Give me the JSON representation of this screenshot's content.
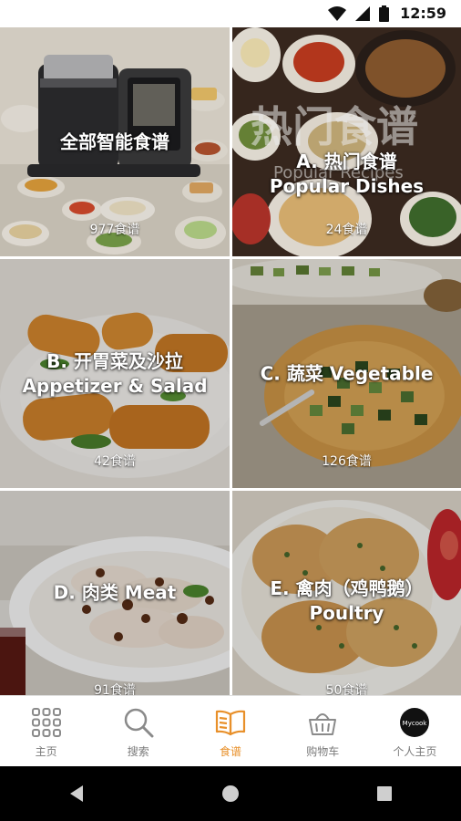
{
  "status_bar": {
    "time": "12:59"
  },
  "tiles": [
    {
      "title": "全部智能食谱",
      "count": "977食谱"
    },
    {
      "title": "A. 热门食谱\nPopular Dishes",
      "count": "24食谱",
      "watermark_cn": "热门食谱",
      "watermark_en": "Popular Recipes"
    },
    {
      "title": "B. 开胃菜及沙拉\nAppetizer & Salad",
      "count": "42食谱"
    },
    {
      "title": "C. 蔬菜 Vegetable",
      "count": "126食谱"
    },
    {
      "title": "D. 肉类 Meat",
      "count": "91食谱"
    },
    {
      "title": "E. 禽肉（鸡鸭鹅）\nPoultry",
      "count": "50食谱"
    }
  ],
  "bottom_nav": {
    "items": [
      {
        "label": "主页",
        "icon": "grid-icon"
      },
      {
        "label": "搜索",
        "icon": "search-icon"
      },
      {
        "label": "食谱",
        "icon": "book-icon",
        "active": true
      },
      {
        "label": "购物车",
        "icon": "basket-icon"
      },
      {
        "label": "个人主页",
        "icon": "profile-logo",
        "logo_text": "Mycook"
      }
    ]
  },
  "colors": {
    "accent": "#e8902a",
    "nav_label": "#7a7a7a"
  }
}
